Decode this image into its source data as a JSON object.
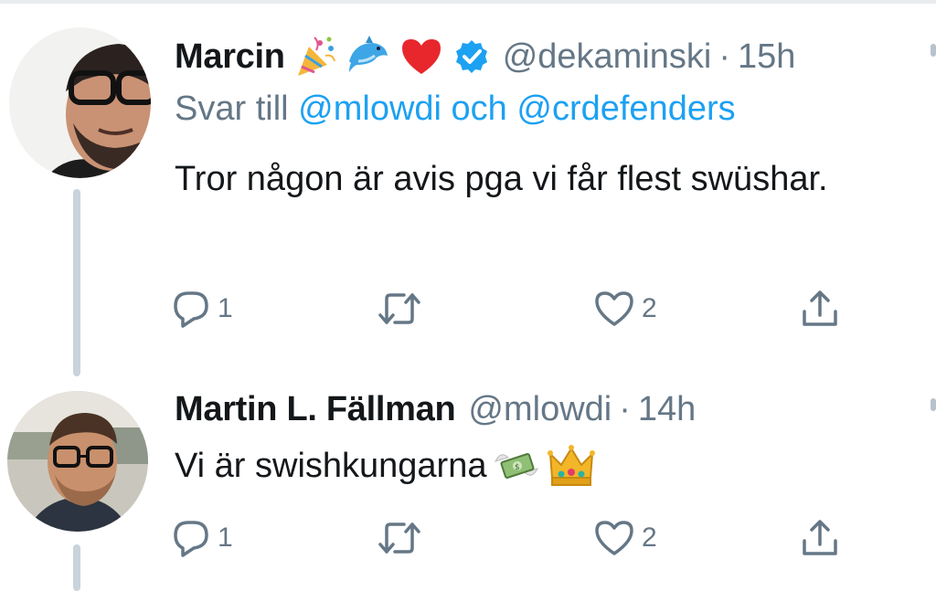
{
  "tweets": [
    {
      "name": "Marcin",
      "emojis": [
        "party-popper",
        "dolphin",
        "red-heart"
      ],
      "verified": true,
      "handle": "@dekaminski",
      "separator": "·",
      "time": "15h",
      "reply_prefix": "Svar till",
      "reply_mention_1": "@mlowdi",
      "reply_conjunction": "och",
      "reply_mention_2": "@crdefenders",
      "text": "Tror någon är avis pga vi får flest swüshar.",
      "replies": "1",
      "retweets": "",
      "likes": "2"
    },
    {
      "name": "Martin L. Fällman",
      "handle": "@mlowdi",
      "separator": "·",
      "time": "14h",
      "text": "Vi är swishkungarna",
      "text_emojis": [
        "money-with-wings",
        "crown"
      ],
      "replies": "1",
      "retweets": "",
      "likes": "2"
    }
  ],
  "colors": {
    "text": "#14171a",
    "secondary": "#657786",
    "link": "#1da1f2",
    "verified": "#1da1f2",
    "thread_line": "#c9d3db"
  }
}
